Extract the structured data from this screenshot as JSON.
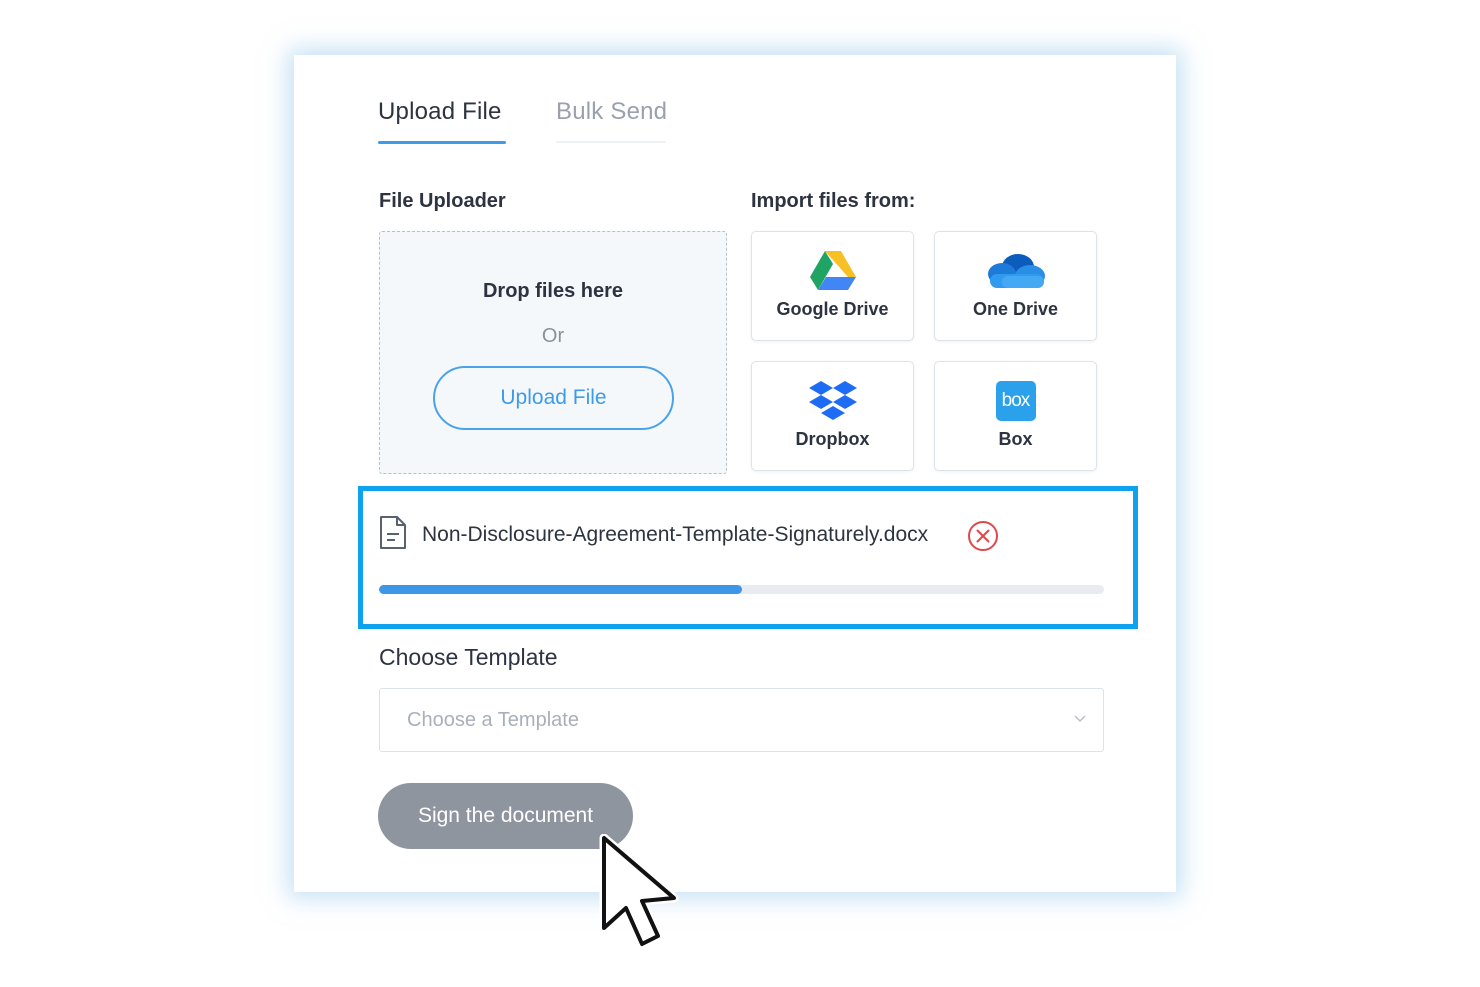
{
  "tabs": [
    {
      "label": "Upload File",
      "active": true
    },
    {
      "label": "Bulk Send",
      "active": false
    }
  ],
  "uploader": {
    "label": "File Uploader",
    "drop_text": "Drop files here",
    "or_text": "Or",
    "button_label": "Upload File"
  },
  "import": {
    "label": "Import files from:",
    "sources": [
      {
        "label": "Google Drive",
        "icon": "google-drive-icon"
      },
      {
        "label": "One Drive",
        "icon": "onedrive-icon"
      },
      {
        "label": "Dropbox",
        "icon": "dropbox-icon"
      },
      {
        "label": "Box",
        "icon": "box-icon",
        "icon_text": "box"
      }
    ]
  },
  "uploaded_file": {
    "name": "Non-Disclosure-Agreement-Template-Signaturely.docx",
    "progress_percent": 50,
    "icon": "document-icon",
    "remove_icon": "close-circle-icon"
  },
  "template": {
    "label": "Choose Template",
    "placeholder": "Choose a Template"
  },
  "sign_button": {
    "label": "Sign the document"
  },
  "colors": {
    "accent": "#3d9be9",
    "highlight": "#0fa3ef",
    "remove": "#e0484a",
    "sign_button": "#8e959f"
  }
}
